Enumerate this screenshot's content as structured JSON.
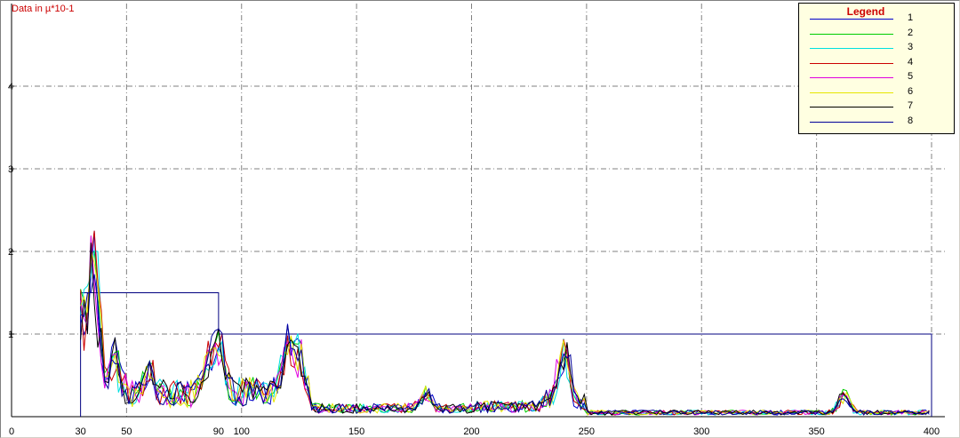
{
  "chart_data": {
    "type": "line",
    "y_axis_title": "Data in µ*10-1",
    "x_ticks": [
      0,
      30,
      50,
      90,
      100,
      150,
      200,
      250,
      300,
      350,
      400
    ],
    "y_ticks": [
      1,
      2,
      3,
      4
    ],
    "xlim": [
      0,
      400
    ],
    "ylim": [
      0,
      5
    ],
    "grid": true,
    "legend_position": "top-right",
    "legend_title": "Legend",
    "series": [
      {
        "name": "1",
        "color": "#0000cc"
      },
      {
        "name": "2",
        "color": "#00cc00"
      },
      {
        "name": "3",
        "color": "#00e0e0"
      },
      {
        "name": "4",
        "color": "#cc0000"
      },
      {
        "name": "5",
        "color": "#e000e0"
      },
      {
        "name": "6",
        "color": "#e6e600"
      },
      {
        "name": "7",
        "color": "#000000"
      },
      {
        "name": "8",
        "color": "#000099"
      }
    ],
    "threshold_box": {
      "segments": [
        {
          "x_start": 30,
          "x_end": 90,
          "y": 1.5
        },
        {
          "x_start": 90,
          "x_end": 400,
          "y": 1.0
        }
      ]
    },
    "peaks": [
      {
        "x": 30,
        "y": 1.3
      },
      {
        "x": 35,
        "y": 2.2
      },
      {
        "x": 38,
        "y": 0.6
      },
      {
        "x": 45,
        "y": 0.7
      },
      {
        "x": 60,
        "y": 0.4
      },
      {
        "x": 85,
        "y": 0.6
      },
      {
        "x": 90,
        "y": 1.05
      },
      {
        "x": 120,
        "y": 1.0
      },
      {
        "x": 125,
        "y": 0.7
      },
      {
        "x": 180,
        "y": 0.3
      },
      {
        "x": 240,
        "y": 1.1
      },
      {
        "x": 362,
        "y": 0.35
      }
    ]
  }
}
